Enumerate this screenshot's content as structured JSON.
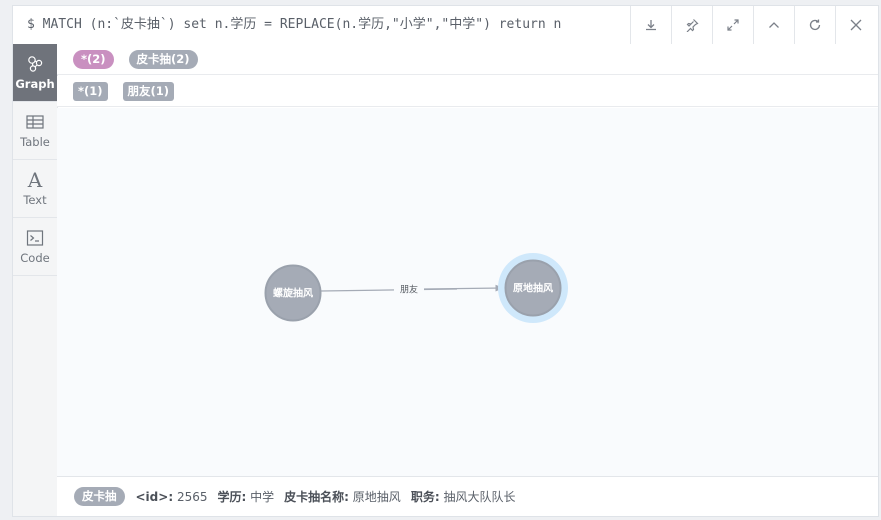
{
  "command": {
    "text": "$ MATCH (n:`皮卡抽`) set n.学历 = REPLACE(n.学历,\"小学\",\"中学\") return n"
  },
  "toolbar": {
    "buttons": [
      {
        "name": "download-button",
        "icon": "download-icon"
      },
      {
        "name": "pin-button",
        "icon": "pin-icon"
      },
      {
        "name": "fullscreen-button",
        "icon": "expand-icon"
      },
      {
        "name": "collapse-button",
        "icon": "chevron-up-icon"
      },
      {
        "name": "rerun-button",
        "icon": "refresh-icon"
      },
      {
        "name": "close-button",
        "icon": "close-icon"
      }
    ]
  },
  "view_tabs": [
    {
      "label": "Graph",
      "icon": "graph-icon",
      "active": true
    },
    {
      "label": "Table",
      "icon": "table-icon",
      "active": false
    },
    {
      "label": "Text",
      "icon": "text-icon",
      "active": false
    },
    {
      "label": "Code",
      "icon": "code-icon",
      "active": false
    }
  ],
  "legend": {
    "node_labels": [
      {
        "text": "*(2)",
        "color": "#c990c0"
      },
      {
        "text": "皮卡抽(2)",
        "color": "#a5abb6"
      }
    ],
    "relationship_types": [
      {
        "text": "*(1)",
        "color": "#a5abb6"
      },
      {
        "text": "朋友(1)",
        "color": "#a5abb6"
      }
    ]
  },
  "graph": {
    "nodes": [
      {
        "id": "n1",
        "label": "螺旋抽风",
        "color": "#a5abb6",
        "selected": false
      },
      {
        "id": "n2",
        "label": "原地抽风",
        "color": "#a5abb6",
        "selected": true
      }
    ],
    "relationships": [
      {
        "from": "n1",
        "to": "n2",
        "type": "朋友"
      }
    ],
    "selection_ring_color": "#cfe8fb"
  },
  "inspector": {
    "label_pill": "皮卡抽",
    "label_color": "#a5abb6",
    "props": [
      {
        "key": "<id>:",
        "value": "2565"
      },
      {
        "key": "学历:",
        "value": "中学"
      },
      {
        "key": "皮卡抽名称:",
        "value": "原地抽风"
      },
      {
        "key": "职务:",
        "value": "抽风大队队长"
      }
    ]
  }
}
